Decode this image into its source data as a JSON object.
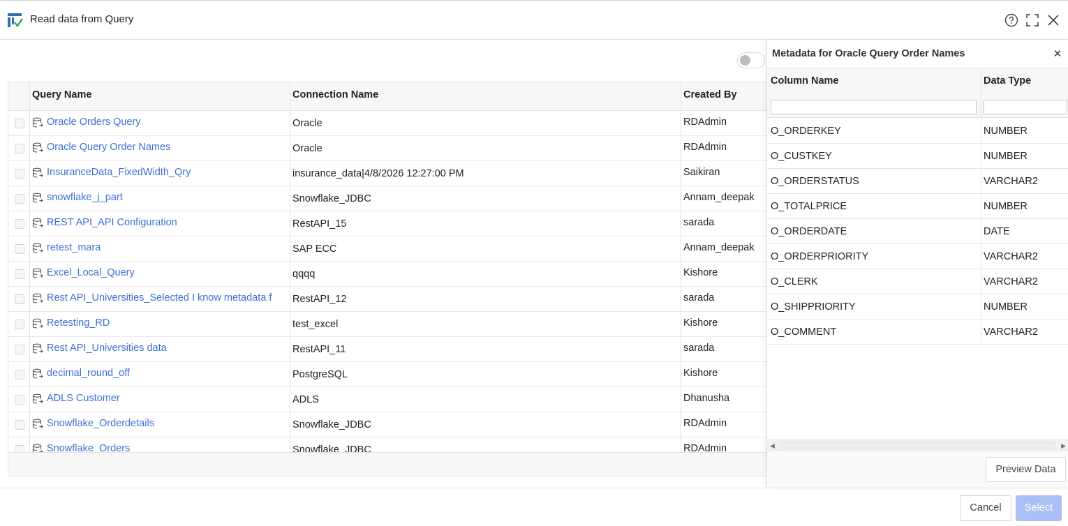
{
  "dialog": {
    "title": "Read data from Query",
    "icons": {
      "app": "app-logo-icon",
      "help": "help-icon",
      "maximize": "maximize-icon",
      "close": "close-icon"
    }
  },
  "grid": {
    "columns": {
      "query_name": "Query Name",
      "connection_name": "Connection Name",
      "created_by": "Created By"
    },
    "rows": [
      {
        "name": "Oracle Orders Query",
        "connection": "Oracle",
        "created_by": "RDAdmin"
      },
      {
        "name": "Oracle Query Order Names",
        "connection": "Oracle",
        "created_by": "RDAdmin"
      },
      {
        "name": "InsuranceData_FixedWidth_Qry",
        "connection": "insurance_data|4/8/2026 12:27:00 PM",
        "created_by": "Saikiran"
      },
      {
        "name": "snowflake_j_part",
        "connection": "Snowflake_JDBC",
        "created_by": "Annam_deepak"
      },
      {
        "name": "REST API_API Configuration",
        "connection": "RestAPI_15",
        "created_by": "sarada"
      },
      {
        "name": "retest_mara",
        "connection": "SAP ECC",
        "created_by": "Annam_deepak"
      },
      {
        "name": "Excel_Local_Query",
        "connection": "qqqq",
        "created_by": "Kishore"
      },
      {
        "name": "Rest API_Universities_Selected I know metadata f",
        "connection": "RestAPI_12",
        "created_by": "sarada"
      },
      {
        "name": "Retesting_RD",
        "connection": "test_excel",
        "created_by": "Kishore"
      },
      {
        "name": "Rest API_Universities data",
        "connection": "RestAPI_11",
        "created_by": "sarada"
      },
      {
        "name": "decimal_round_off",
        "connection": "PostgreSQL",
        "created_by": "Kishore"
      },
      {
        "name": "ADLS Customer",
        "connection": "ADLS",
        "created_by": "Dhanusha"
      },
      {
        "name": "Snowflake_Orderdetails",
        "connection": "Snowflake_JDBC",
        "created_by": "RDAdmin"
      },
      {
        "name": "Snowflake_Orders",
        "connection": "Snowflake_JDBC",
        "created_by": "RDAdmin"
      }
    ]
  },
  "metadata_panel": {
    "title": "Metadata for Oracle Query Order Names",
    "columns": {
      "column_name": "Column Name",
      "data_type": "Data Type"
    },
    "filters": {
      "column_name": "",
      "data_type": ""
    },
    "rows": [
      {
        "column": "O_ORDERKEY",
        "type": "NUMBER"
      },
      {
        "column": "O_CUSTKEY",
        "type": "NUMBER"
      },
      {
        "column": "O_ORDERSTATUS",
        "type": "VARCHAR2"
      },
      {
        "column": "O_TOTALPRICE",
        "type": "NUMBER"
      },
      {
        "column": "O_ORDERDATE",
        "type": "DATE"
      },
      {
        "column": "O_ORDERPRIORITY",
        "type": "VARCHAR2"
      },
      {
        "column": "O_CLERK",
        "type": "VARCHAR2"
      },
      {
        "column": "O_SHIPPRIORITY",
        "type": "NUMBER"
      },
      {
        "column": "O_COMMENT",
        "type": "VARCHAR2"
      }
    ],
    "preview_label": "Preview Data"
  },
  "footer": {
    "cancel_label": "Cancel",
    "select_label": "Select"
  },
  "colors": {
    "link": "#3d6fd6",
    "select_disabled": "#a9bff5",
    "app_icon_blue": "#2f6fb3",
    "app_icon_green": "#3aa655"
  }
}
